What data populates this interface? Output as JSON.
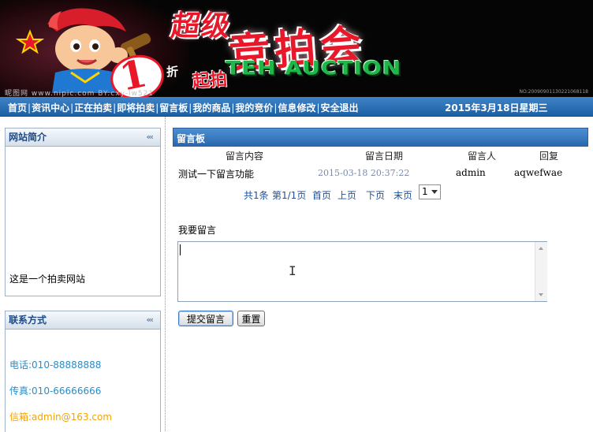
{
  "banner": {
    "title_cn_top": "超级",
    "title_cn_main": "竞拍会",
    "title_en": "TEH AUCTION",
    "badge_number": "1",
    "badge_zhe": "折",
    "badge_qipai": "起拍",
    "watermark_left": "昵图网 www.nipic.com  BY:cxy-lw521",
    "watermark_right": "NO:20090901130221068118"
  },
  "nav": {
    "items": [
      "首页",
      "资讯中心",
      "正在拍卖",
      "即将拍卖",
      "留言板",
      "我的商品",
      "我的竞价",
      "信息修改",
      "安全退出"
    ],
    "separator": "|",
    "date": "2015年3月18日星期三"
  },
  "sidebar": {
    "intro": {
      "title": "网站简介",
      "arrows": "‹‹‹",
      "text": "这是一个拍卖网站"
    },
    "contact": {
      "title": "联系方式",
      "arrows": "‹‹‹",
      "phone": "电话:010-88888888",
      "fax": "传真:010-66666666",
      "email": "信箱:admin@163.com"
    }
  },
  "main": {
    "title": "留言板",
    "columns": [
      "留言内容",
      "留言日期",
      "留言人",
      "回复"
    ],
    "messages": [
      {
        "content": "测试一下留言功能",
        "date": "2015-03-18 20:37:22",
        "user": "admin",
        "reply": "aqwefwae"
      }
    ],
    "pager": {
      "total": "共1条",
      "page_info": "第1/1页",
      "first": "首页",
      "prev": "上页",
      "next": "下页",
      "last": "末页",
      "selected_page": "1"
    },
    "compose": {
      "label": "我要留言",
      "textarea_value": "",
      "submit_label": "提交留言",
      "reset_label": "重置"
    }
  }
}
